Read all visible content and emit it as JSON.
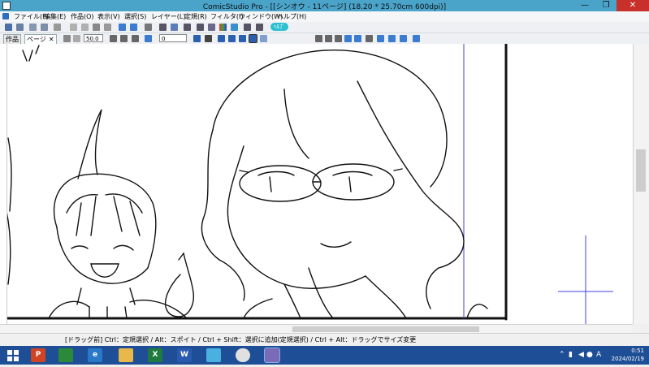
{
  "window": {
    "title": "ComicStudio Pro - [[シンオウ - 11ページ] (18.20 * 25.70cm 600dpi)]",
    "minimize": "—",
    "restore": "❐",
    "close": "✕"
  },
  "menubar": {
    "items": [
      "ファイル(F)",
      "編集(E)",
      "作品(O)",
      "表示(V)",
      "選択(S)",
      "レイヤー(L)",
      "定規(R)",
      "フィルタ(I)",
      "ウィンドウ(W)",
      "ヘルプ(H)"
    ]
  },
  "toolbar": {
    "badge_label": "ﾍﾙﾌﾟ"
  },
  "toolbar2": {
    "tabs": [
      {
        "label": "作品"
      },
      {
        "label": "ページ",
        "close": "✕"
      }
    ],
    "zoom_value": "50.0",
    "angle_value": "0"
  },
  "statusbar": {
    "hint": "[ドラッグ前] Ctrl：定規選択 / Alt：スポイト / Ctrl + Shift：選択に追加(定規選択) / Ctrl + Alt：ドラッグでサイズ変更"
  },
  "taskbar": {
    "apps": [
      {
        "name": "start",
        "label": ""
      },
      {
        "name": "powerpoint",
        "label": "P"
      },
      {
        "name": "store",
        "label": ""
      },
      {
        "name": "browser-e",
        "label": "e"
      },
      {
        "name": "explorer",
        "label": ""
      },
      {
        "name": "excel",
        "label": "X"
      },
      {
        "name": "word",
        "label": "W"
      },
      {
        "name": "app-7",
        "label": ""
      },
      {
        "name": "chrome",
        "label": ""
      },
      {
        "name": "comicstudio",
        "label": ""
      }
    ],
    "ime_label": "A",
    "time": "0:51",
    "date": "2024/02/19"
  },
  "colors": {
    "titlebar": "#4aa3c9",
    "taskbar": "#1e4f96",
    "close": "#c7302b",
    "guide": "#4040e0"
  }
}
